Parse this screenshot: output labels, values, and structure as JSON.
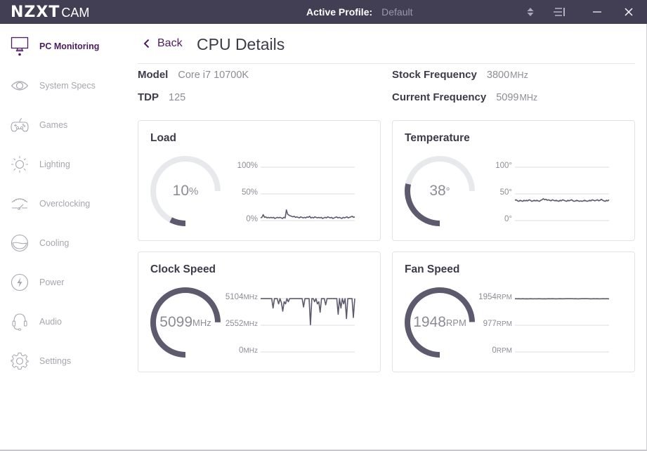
{
  "titlebar": {
    "logo_brand": "NZXT",
    "logo_product": "CAM",
    "profile_label": "Active Profile:",
    "profile_value": "Default",
    "icons": [
      "profile-switch-icon",
      "menu-icon",
      "minimize-icon",
      "close-icon"
    ]
  },
  "sidebar": {
    "items": [
      {
        "label": "PC Monitoring",
        "icon": "monitor-icon",
        "active": true
      },
      {
        "label": "System Specs",
        "icon": "eye-icon",
        "active": false
      },
      {
        "label": "Games",
        "icon": "gamepad-icon",
        "active": false
      },
      {
        "label": "Lighting",
        "icon": "sun-icon",
        "active": false
      },
      {
        "label": "Overclocking",
        "icon": "speedometer-icon",
        "active": false
      },
      {
        "label": "Cooling",
        "icon": "cooling-icon",
        "active": false
      },
      {
        "label": "Power",
        "icon": "lightning-icon",
        "active": false
      },
      {
        "label": "Audio",
        "icon": "headset-icon",
        "active": false
      },
      {
        "label": "Settings",
        "icon": "gear-icon",
        "active": false
      }
    ]
  },
  "main": {
    "back_label": "Back",
    "title": "CPU Details",
    "specs": {
      "model_label": "Model",
      "model_value": "Core i7 10700K",
      "tdp_label": "TDP",
      "tdp_value": "125",
      "stock_label": "Stock Frequency",
      "stock_value": "3800",
      "stock_unit": "MHz",
      "current_label": "Current Frequency",
      "current_value": "5099",
      "current_unit": "MHz"
    }
  },
  "colors": {
    "titlebar_bg": "#423f55",
    "accent": "#4d1b5f",
    "gauge_fill": "#5d5a6e",
    "gauge_track": "#e8e9ed",
    "line": "#5d5a6e"
  },
  "chart_data": [
    {
      "type": "line",
      "title": "Load",
      "gauge_value": "10",
      "gauge_unit": "%",
      "gauge_fraction": 0.1,
      "ticks": [
        {
          "value": "100",
          "unit": "%"
        },
        {
          "value": "50",
          "unit": "%"
        },
        {
          "value": "0",
          "unit": "%"
        }
      ],
      "ylim": [
        0,
        100
      ],
      "values": [
        5,
        6,
        11,
        6,
        7,
        5,
        6,
        5,
        6,
        5,
        6,
        4,
        5,
        6,
        5,
        6,
        5,
        4,
        6,
        5,
        20,
        12,
        10,
        9,
        8,
        7,
        8,
        6,
        7,
        6,
        5,
        7,
        6,
        5,
        6,
        5,
        7,
        6,
        8,
        5,
        6,
        5,
        7,
        6,
        5,
        6,
        5,
        6,
        4,
        5,
        6,
        5,
        7,
        6,
        5,
        6,
        4,
        5,
        6,
        7,
        5,
        6,
        5,
        4,
        6,
        5,
        6,
        7,
        5,
        6,
        7,
        8,
        6,
        7
      ]
    },
    {
      "type": "line",
      "title": "Temperature",
      "gauge_value": "38",
      "gauge_unit": "°",
      "gauge_fraction": 0.38,
      "ticks": [
        {
          "value": "100",
          "unit": "°"
        },
        {
          "value": "50",
          "unit": "°"
        },
        {
          "value": "0",
          "unit": "°"
        }
      ],
      "ylim": [
        0,
        100
      ],
      "values": [
        38,
        39,
        37,
        36,
        38,
        37,
        36,
        38,
        37,
        38,
        37,
        39,
        38,
        36,
        37,
        38,
        37,
        38,
        37,
        36,
        38,
        39,
        41,
        39,
        40,
        38,
        39,
        38,
        37,
        39,
        38,
        37,
        38,
        37,
        36,
        38,
        37,
        39,
        38,
        37,
        36,
        38,
        37,
        38,
        39,
        37,
        36,
        37,
        38,
        37,
        36,
        37,
        36,
        37,
        38,
        37,
        36,
        37,
        38,
        37,
        39,
        38,
        37,
        38,
        39,
        37,
        38,
        40,
        38,
        37,
        36,
        38,
        37,
        39
      ]
    },
    {
      "type": "line",
      "title": "Clock Speed",
      "gauge_value": "5099",
      "gauge_unit": "MHz",
      "gauge_fraction": 0.999,
      "ticks": [
        {
          "value": "5104",
          "unit": "MHz"
        },
        {
          "value": "2552",
          "unit": "MHz"
        },
        {
          "value": "0",
          "unit": "MHz"
        }
      ],
      "ylim": [
        0,
        5104
      ],
      "values": [
        5100,
        5100,
        5100,
        5100,
        5100,
        5100,
        5100,
        5100,
        5100,
        4200,
        5100,
        5100,
        5100,
        4600,
        5100,
        4700,
        3900,
        4800,
        4600,
        5100,
        4800,
        5100,
        5100,
        5100,
        5100,
        5100,
        5100,
        5100,
        5100,
        5100,
        5100,
        4300,
        5100,
        5100,
        5100,
        5100,
        2600,
        5100,
        5100,
        4800,
        5100,
        4600,
        4800,
        3800,
        5100,
        5100,
        5100,
        4500,
        5100,
        5100,
        5100,
        5100,
        5100,
        5100,
        5100,
        5100,
        3600,
        5100,
        4200,
        5100,
        4600,
        5100,
        3200,
        5100,
        5100,
        5100,
        5100,
        3300,
        5100
      ]
    },
    {
      "type": "line",
      "title": "Fan Speed",
      "gauge_value": "1948",
      "gauge_unit": "RPM",
      "gauge_fraction": 0.997,
      "ticks": [
        {
          "value": "1954",
          "unit": "RPM"
        },
        {
          "value": "977",
          "unit": "RPM"
        },
        {
          "value": "0",
          "unit": "RPM"
        }
      ],
      "ylim": [
        0,
        1954
      ],
      "values": [
        1948,
        1946,
        1949,
        1945,
        1948,
        1944,
        1947,
        1945,
        1948,
        1944,
        1947,
        1945,
        1948,
        1946,
        1944,
        1947,
        1945,
        1948,
        1946,
        1949,
        1946,
        1944,
        1947,
        1948,
        1946,
        1947,
        1948,
        1948,
        1948,
        1948,
        1946,
        1948,
        1945,
        1947,
        1948,
        1948,
        1948,
        1948,
        1947,
        1945,
        1948,
        1947,
        1948,
        1944,
        1947,
        1948,
        1946,
        1948,
        1945
      ]
    }
  ]
}
